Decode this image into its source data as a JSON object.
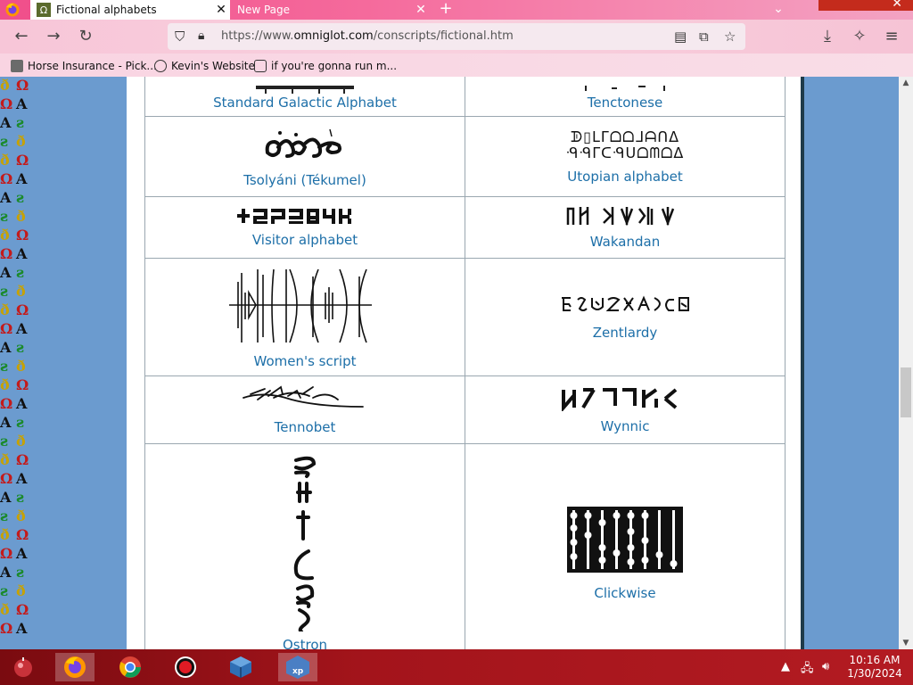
{
  "browser": {
    "tabs": [
      {
        "title": "Fictional alphabets",
        "active": true
      },
      {
        "title": "New Page",
        "active": false
      }
    ],
    "url_prefix": "https://www.",
    "url_domain": "omniglot.com",
    "url_path": "/conscripts/fictional.htm",
    "bookmarks": [
      {
        "label": "Horse Insurance - Pick...",
        "icon": "bookmark-icon"
      },
      {
        "label": "Kevin's Website",
        "icon": "globe-icon"
      },
      {
        "label": "if you're gonna run m...",
        "icon": "ornament-icon"
      }
    ]
  },
  "alphabets": [
    {
      "name": "Standard Galactic Alphabet",
      "glyph": "ᒋᑑ∷╎⊣ℸ ̣⍑ᒷ ⋮"
    },
    {
      "name": "Tenctonese",
      "glyph": "ᓭ ⋰ ⌒ ⟋"
    },
    {
      "name": "Tsolyáni (Tékumel)",
      "glyph": "ꪻꪖꪶꪑ"
    },
    {
      "name": "Utopian alphabet",
      "glyph_top": "ᗫ▯ᒪᒥᗝᗝᒧᗩᑎᐃ",
      "glyph_bottom": "ᑴᑴᒥᑕᑴᑌᗝᗰᗝᐃ"
    },
    {
      "name": "Visitor alphabet",
      "glyph": "ᚁᑦᑭᒉᗷᒍᖽᖾ"
    },
    {
      "name": "Wakandan",
      "glyph": "ᛏᛋ ᛋᛉ ᛏᛋ ᛉ"
    },
    {
      "name": "Women's script",
      "glyph": ""
    },
    {
      "name": "Zentlardy",
      "glyph": "ꝶꞇꝺꝷꝸꝵꝴꝰꝲ"
    },
    {
      "name": "Tennobet",
      "glyph": ""
    },
    {
      "name": "Wynnic",
      "glyph": "ᚢᚤᛚᛚᚷᚪᚲ"
    },
    {
      "name": "Ostron",
      "glyph": ""
    },
    {
      "name": "Clickwise",
      "glyph": ""
    }
  ],
  "taskbar": {
    "time": "10:16 AM",
    "date": "1/30/2024"
  }
}
